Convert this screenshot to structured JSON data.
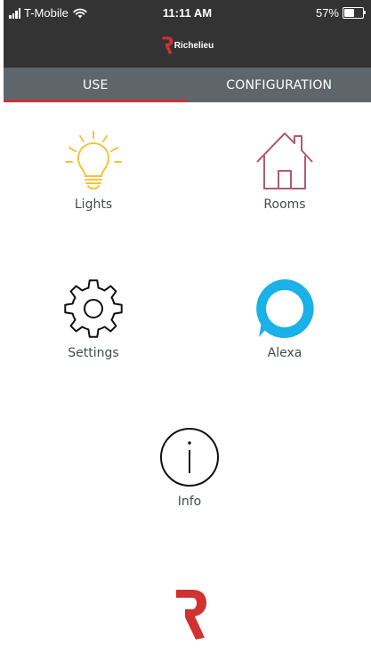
{
  "status_bar": {
    "carrier": "T-Mobile",
    "time": "11:11 AM",
    "battery": "57%",
    "battery_level": 0.57,
    "icons": [
      "signal-icon",
      "wifi-icon",
      "battery-icon"
    ]
  },
  "header": {
    "brand": "Richelieu",
    "brand_color": "#d0322f"
  },
  "tabs": [
    {
      "label": "USE",
      "active": true
    },
    {
      "label": "CONFIGURATION",
      "active": false
    }
  ],
  "tiles": [
    {
      "label": "Lights",
      "icon": "lightbulb-icon",
      "color": "#f5c33b"
    },
    {
      "label": "Rooms",
      "icon": "house-icon",
      "color": "#b05a72"
    },
    {
      "label": "Settings",
      "icon": "gear-icon",
      "color": "#111111"
    },
    {
      "label": "Alexa",
      "icon": "alexa-icon",
      "color": "#1ab0e8"
    },
    {
      "label": "Info",
      "icon": "info-icon",
      "color": "#111111"
    }
  ],
  "colors": {
    "header_bg": "#333333",
    "tab_bg": "#5e666c",
    "accent": "#d0322f"
  }
}
